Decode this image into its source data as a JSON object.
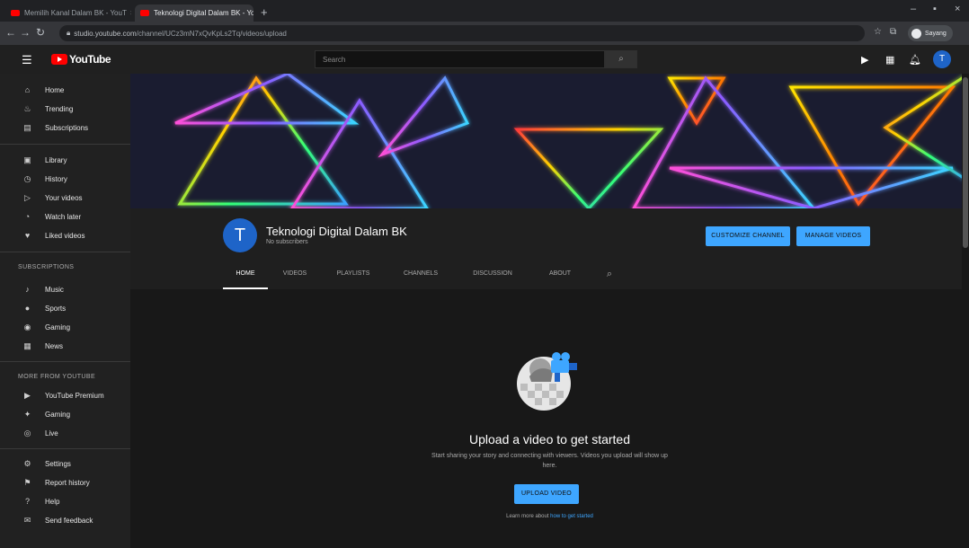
{
  "browser": {
    "tabs": [
      {
        "label": "Memilih Kanal Dalam BK - YouT",
        "close": "×"
      },
      {
        "label": "Teknologi Digital Dalam BK - Yo",
        "close": "×"
      }
    ],
    "new_tab": "+",
    "window_controls": {
      "minimize": "–",
      "maximize": "▪",
      "close": "×"
    },
    "url_host": "studio.youtube.com",
    "url_path": "/channel/UCz3mN7xQvKpLs2Tq/videos/upload",
    "profile_label": "Sayang"
  },
  "masthead": {
    "logo": "YouTube",
    "search_placeholder": "Search",
    "search_icon": "search-icon",
    "avatar_letter": "T"
  },
  "sidebar": {
    "main": [
      {
        "label": "Home",
        "icon": "⌂"
      },
      {
        "label": "Trending",
        "icon": "♨"
      },
      {
        "label": "Subscriptions",
        "icon": "▤"
      }
    ],
    "library": [
      {
        "label": "Library",
        "icon": "▣"
      },
      {
        "label": "History",
        "icon": "◷"
      },
      {
        "label": "Your videos",
        "icon": "▷"
      },
      {
        "label": "Watch later",
        "icon": "◔"
      },
      {
        "label": "Liked videos",
        "icon": "♥"
      }
    ],
    "subscriptions_heading": "SUBSCRIPTIONS",
    "subscriptions": [
      {
        "label": "Music",
        "icon": "♪"
      },
      {
        "label": "Sports",
        "icon": "●"
      },
      {
        "label": "Gaming",
        "icon": "◉"
      },
      {
        "label": "News",
        "icon": "▦"
      }
    ],
    "more_heading": "MORE FROM YOUTUBE",
    "more": [
      {
        "label": "YouTube Premium",
        "icon": "▶"
      },
      {
        "label": "Gaming",
        "icon": "✦"
      },
      {
        "label": "Live",
        "icon": "◎"
      }
    ],
    "footer": [
      {
        "label": "Settings",
        "icon": "⚙"
      },
      {
        "label": "Report history",
        "icon": "⚑"
      },
      {
        "label": "Help",
        "icon": "?"
      },
      {
        "label": "Send feedback",
        "icon": "✉"
      }
    ]
  },
  "channel": {
    "avatar_letter": "T",
    "title": "Teknologi Digital Dalam BK",
    "subscribers": "No subscribers",
    "customize_button": "CUSTOMIZE CHANNEL",
    "manage_button": "MANAGE VIDEOS",
    "tabs": [
      "HOME",
      "VIDEOS",
      "PLAYLISTS",
      "CHANNELS",
      "DISCUSSION",
      "ABOUT"
    ],
    "active_tab": "HOME",
    "search_tab_icon": "search-icon"
  },
  "empty_state": {
    "title": "Upload a video to get started",
    "description": "Start sharing your story and connecting with viewers. Videos you upload will show up here.",
    "upload_button": "UPLOAD VIDEO",
    "learn_more_prefix": "Learn more about",
    "learn_more_link": "how to get started"
  },
  "colors": {
    "accent": "#3ea6ff",
    "brand_red": "#ff0000",
    "avatar_blue": "#1e64c8"
  }
}
